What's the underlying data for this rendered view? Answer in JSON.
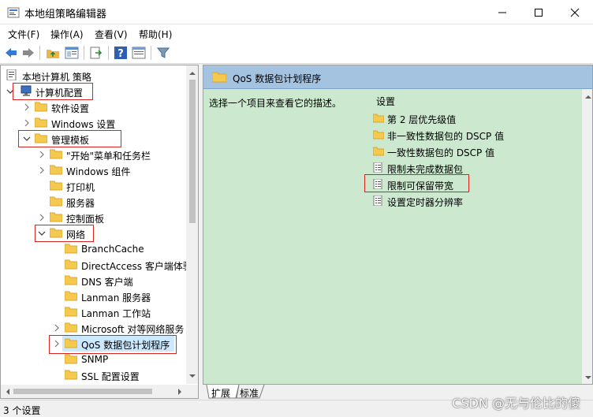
{
  "window": {
    "title": "本地组策略编辑器"
  },
  "menu": [
    "文件(F)",
    "操作(A)",
    "查看(V)",
    "帮助(H)"
  ],
  "tree": {
    "root": "本地计算机 策略",
    "computer_config": "计算机配置",
    "software_settings": "软件设置",
    "windows_settings": "Windows 设置",
    "admin_templates": "管理模板",
    "start_menu": "\"开始\"菜单和任务栏",
    "windows_components": "Windows 组件",
    "printers": "打印机",
    "server": "服务器",
    "control_panel": "控制面板",
    "network": "网络",
    "branchcache": "BranchCache",
    "directaccess": "DirectAccess 客户端体验",
    "dns_client": "DNS 客户端",
    "lanman_server": "Lanman 服务器",
    "lanman_workstation": "Lanman 工作站",
    "microsoft_p2p": "Microsoft 对等网络服务",
    "qos": "QoS 数据包计划程序",
    "snmp": "SNMP",
    "ssl": "SSL 配置设置"
  },
  "content": {
    "header": "QoS 数据包计划程序",
    "description": "选择一个项目来查看它的描述。",
    "column": "设置",
    "items": [
      {
        "label": "第 2 层优先级值",
        "icon": "folder-icon"
      },
      {
        "label": "非一致性数据包的 DSCP 值",
        "icon": "folder-icon"
      },
      {
        "label": "一致性数据包的 DSCP 值",
        "icon": "folder-icon"
      },
      {
        "label": "限制未完成数据包",
        "icon": "policy-setting-icon"
      },
      {
        "label": "限制可保留带宽",
        "icon": "policy-setting-icon"
      },
      {
        "label": "设置定时器分辨率",
        "icon": "policy-setting-icon"
      }
    ]
  },
  "tabs": [
    "扩展",
    "标准"
  ],
  "status": "3 个设置",
  "watermark": "CSDN @无与伦比的傻",
  "colors": {
    "content_bg": "#cce8cf",
    "header_bg": "#a4c3e0",
    "highlight_box": "#d9241f",
    "selected_row": "#cce8ff",
    "folder": "#f5c94f"
  }
}
